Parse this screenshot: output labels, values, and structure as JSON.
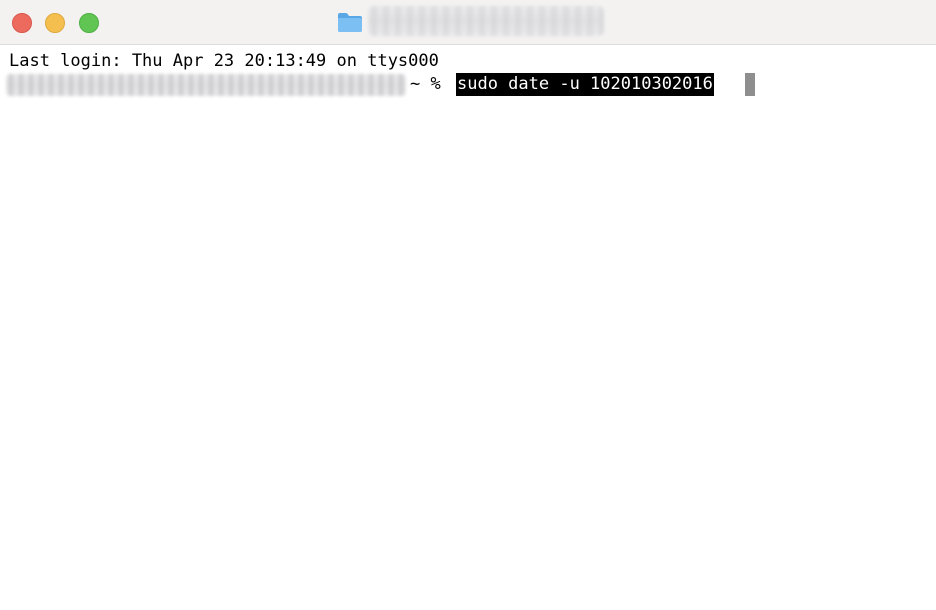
{
  "window": {
    "title_icon": "folder-icon",
    "colors": {
      "close": "#ed6a5e",
      "minimize": "#f5bf4f",
      "maximize": "#61c554",
      "titlebar": "#f3f2f1",
      "selection_bg": "#000000",
      "selection_fg": "#ffffff",
      "cursor": "#8e8e8e"
    }
  },
  "terminal": {
    "last_login": "Last login: Thu Apr 23 20:13:49 on ttys000",
    "prompt_suffix": "~ %",
    "command": "sudo date -u 102010302016"
  }
}
